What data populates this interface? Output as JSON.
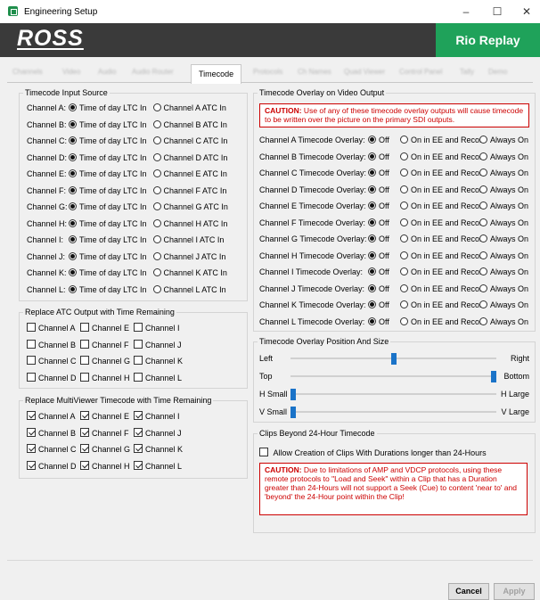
{
  "window": {
    "title": "Engineering Setup",
    "minimize": "–",
    "maximize": "☐",
    "close": "✕"
  },
  "banner": {
    "logo": "ROSS",
    "product": "Rio Replay"
  },
  "tabs": [
    {
      "label": "Channels",
      "active": false
    },
    {
      "label": "Video",
      "active": false
    },
    {
      "label": "Audio",
      "active": false
    },
    {
      "label": "Audio Router",
      "active": false
    },
    {
      "label": "Timecode",
      "active": true
    },
    {
      "label": "Protocols",
      "active": false
    },
    {
      "label": "Ch Names",
      "active": false
    },
    {
      "label": "Quad Viewer",
      "active": false
    },
    {
      "label": "Control Panel",
      "active": false
    },
    {
      "label": "Tally",
      "active": false
    },
    {
      "label": "Demo",
      "active": false
    }
  ],
  "timecode_input": {
    "title": "Timecode Input Source",
    "rows": [
      {
        "label": "Channel A:",
        "opt1": "Time of day LTC In",
        "opt2": "Channel A ATC In",
        "selected": 1
      },
      {
        "label": "Channel B:",
        "opt1": "Time of day LTC In",
        "opt2": "Channel B ATC In",
        "selected": 1
      },
      {
        "label": "Channel C:",
        "opt1": "Time of day LTC In",
        "opt2": "Channel C ATC In",
        "selected": 1
      },
      {
        "label": "Channel D:",
        "opt1": "Time of day LTC In",
        "opt2": "Channel D ATC In",
        "selected": 1
      },
      {
        "label": "Channel E:",
        "opt1": "Time of day LTC In",
        "opt2": "Channel E ATC In",
        "selected": 1
      },
      {
        "label": "Channel F:",
        "opt1": "Time of day LTC In",
        "opt2": "Channel F ATC In",
        "selected": 1
      },
      {
        "label": "Channel G:",
        "opt1": "Time of day LTC In",
        "opt2": "Channel G ATC In",
        "selected": 1
      },
      {
        "label": "Channel H:",
        "opt1": "Time of day LTC In",
        "opt2": "Channel H ATC In",
        "selected": 1
      },
      {
        "label": "Channel I:",
        "opt1": "Time of day LTC In",
        "opt2": "Channel I ATC In",
        "selected": 1
      },
      {
        "label": "Channel J:",
        "opt1": "Time of day LTC In",
        "opt2": "Channel J ATC In",
        "selected": 1
      },
      {
        "label": "Channel K:",
        "opt1": "Time of day LTC In",
        "opt2": "Channel K ATC In",
        "selected": 1
      },
      {
        "label": "Channel L:",
        "opt1": "Time of day LTC In",
        "opt2": "Channel L ATC In",
        "selected": 1
      }
    ]
  },
  "replace_atc": {
    "title": "Replace ATC Output with Time Remaining",
    "rows": [
      [
        {
          "label": "Channel A",
          "checked": false
        },
        {
          "label": "Channel E",
          "checked": false
        },
        {
          "label": "Channel I",
          "checked": false
        }
      ],
      [
        {
          "label": "Channel B",
          "checked": false
        },
        {
          "label": "Channel F",
          "checked": false
        },
        {
          "label": "Channel J",
          "checked": false
        }
      ],
      [
        {
          "label": "Channel C",
          "checked": false
        },
        {
          "label": "Channel G",
          "checked": false
        },
        {
          "label": "Channel K",
          "checked": false
        }
      ],
      [
        {
          "label": "Channel D",
          "checked": false
        },
        {
          "label": "Channel H",
          "checked": false
        },
        {
          "label": "Channel L",
          "checked": false
        }
      ]
    ]
  },
  "replace_mv": {
    "title": "Replace MultiViewer Timecode with Time Remaining",
    "rows": [
      [
        {
          "label": "Channel A",
          "checked": true
        },
        {
          "label": "Channel E",
          "checked": true
        },
        {
          "label": "Channel I",
          "checked": true
        }
      ],
      [
        {
          "label": "Channel B",
          "checked": true
        },
        {
          "label": "Channel F",
          "checked": true
        },
        {
          "label": "Channel J",
          "checked": true
        }
      ],
      [
        {
          "label": "Channel C",
          "checked": true
        },
        {
          "label": "Channel G",
          "checked": true
        },
        {
          "label": "Channel K",
          "checked": true
        }
      ],
      [
        {
          "label": "Channel D",
          "checked": true
        },
        {
          "label": "Channel H",
          "checked": true
        },
        {
          "label": "Channel L",
          "checked": true
        }
      ]
    ]
  },
  "overlay": {
    "title": "Timecode Overlay on Video Output",
    "caution_label": "CAUTION:",
    "caution_text": " Use of any of these timecode overlay outputs will cause timecode to be written over the picture on the primary SDI outputs.",
    "options": [
      "Off",
      "On in EE and Record",
      "Always On"
    ],
    "rows": [
      {
        "label": "Channel A Timecode Overlay:",
        "selected": 0
      },
      {
        "label": "Channel B Timecode Overlay:",
        "selected": 0
      },
      {
        "label": "Channel C Timecode Overlay:",
        "selected": 0
      },
      {
        "label": "Channel D Timecode Overlay:",
        "selected": 0
      },
      {
        "label": "Channel E Timecode Overlay:",
        "selected": 0
      },
      {
        "label": "Channel F Timecode Overlay:",
        "selected": 0
      },
      {
        "label": "Channel G Timecode Overlay:",
        "selected": 0
      },
      {
        "label": "Channel H Timecode Overlay:",
        "selected": 0
      },
      {
        "label": "Channel I Timecode Overlay:",
        "selected": 0
      },
      {
        "label": "Channel J Timecode Overlay:",
        "selected": 0
      },
      {
        "label": "Channel K Timecode Overlay:",
        "selected": 0
      },
      {
        "label": "Channel L Timecode Overlay:",
        "selected": 0
      }
    ]
  },
  "position": {
    "title": "Timecode Overlay Position And Size",
    "sliders": [
      {
        "left": "Left",
        "right": "Right",
        "value": 0.5
      },
      {
        "left": "Top",
        "right": "Bottom",
        "value": 1.0
      },
      {
        "left": "H Small",
        "right": "H Large",
        "value": 0.0
      },
      {
        "left": "V Small",
        "right": "V Large",
        "value": 0.0
      }
    ]
  },
  "clips24": {
    "title": "Clips Beyond 24-Hour Timecode",
    "checkbox_label": "Allow Creation of Clips With Durations longer than 24-Hours",
    "checked": false,
    "caution_label": "CAUTION:",
    "caution_text": " Due to limitations of AMP and VDCP protocols, using these remote protocols to \"Load and Seek\" within a Clip that has a Duration greater than 24-Hours will not support a Seek (Cue) to content 'near to' and 'beyond' the 24-Hour point within the Clip!"
  },
  "footer": {
    "cancel": "Cancel",
    "apply": "Apply"
  }
}
